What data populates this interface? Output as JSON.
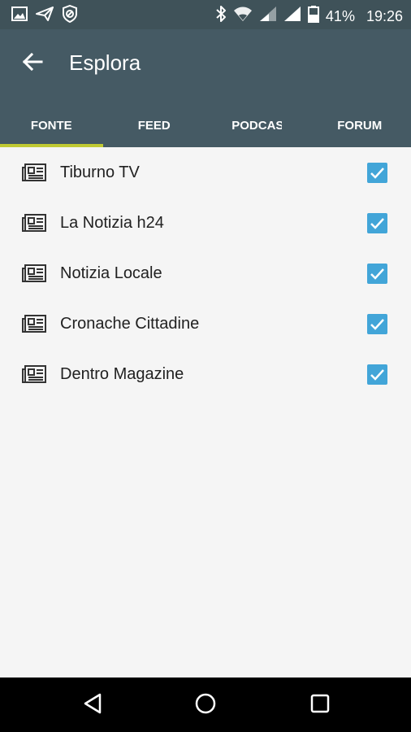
{
  "status_bar": {
    "battery": "41%",
    "time": "19:26",
    "icons": [
      "image-icon",
      "send-icon",
      "shield-icon",
      "bluetooth-icon",
      "wifi-icon",
      "signal-icon",
      "signal-icon",
      "battery-icon"
    ]
  },
  "app_bar": {
    "title": "Esplora",
    "back_icon": "arrow-back-icon"
  },
  "tabs": [
    {
      "label": "FONTE",
      "active": true
    },
    {
      "label": "FEED",
      "active": false
    },
    {
      "label": "PODCAST",
      "active": false
    },
    {
      "label": "FORUM",
      "active": false
    }
  ],
  "sources": [
    {
      "label": "Tiburno TV",
      "checked": true,
      "icon": "newspaper-icon"
    },
    {
      "label": "La Notizia h24",
      "checked": true,
      "icon": "newspaper-icon"
    },
    {
      "label": "Notizia Locale",
      "checked": true,
      "icon": "newspaper-icon"
    },
    {
      "label": "Cronache Cittadine",
      "checked": true,
      "icon": "newspaper-icon"
    },
    {
      "label": "Dentro Magazine",
      "checked": true,
      "icon": "newspaper-icon"
    }
  ],
  "nav_bar": {
    "icons": [
      "back-triangle-icon",
      "home-circle-icon",
      "recents-square-icon"
    ]
  },
  "colors": {
    "app_bar": "#455a64",
    "status_bar": "#3f5259",
    "tab_indicator": "#c0ca33",
    "checkbox": "#42a5d8"
  }
}
